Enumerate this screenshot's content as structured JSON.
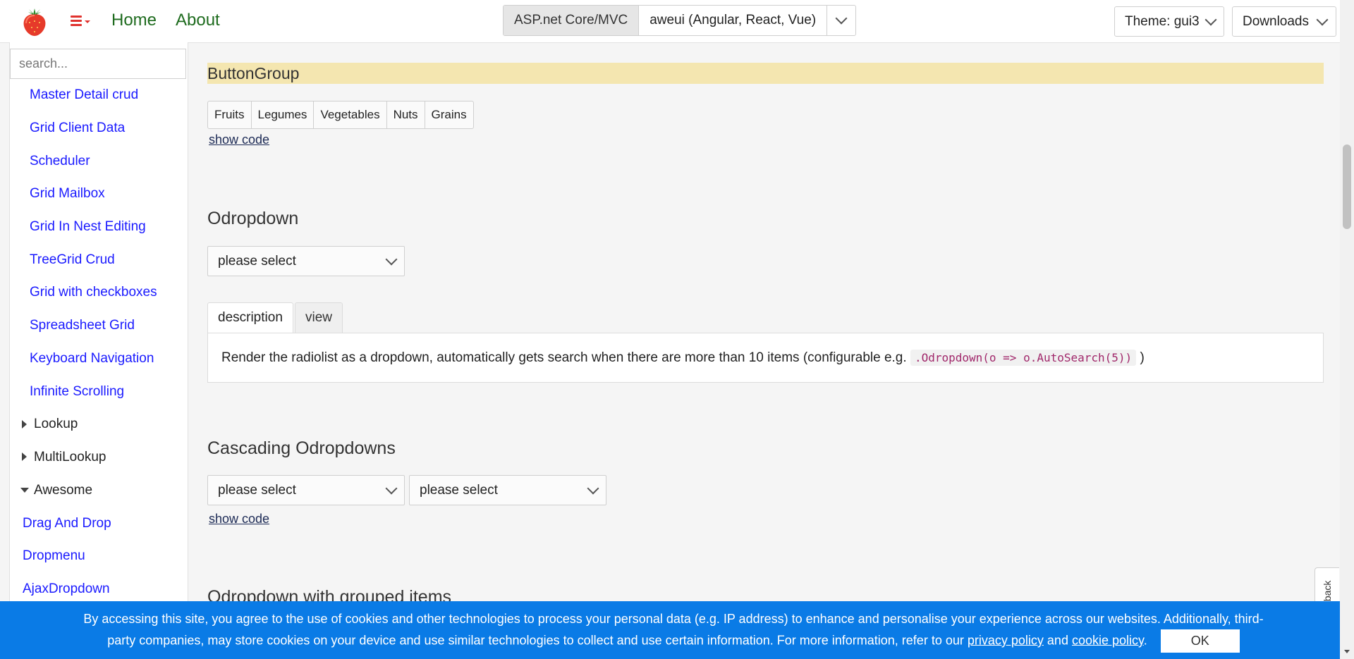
{
  "header": {
    "logo": "strawberry-logo",
    "menu_icon": "hamburger-menu-icon",
    "nav": {
      "home": "Home",
      "about": "About"
    },
    "platform_options": [
      {
        "label": "ASP.net Core/MVC",
        "selected": true
      },
      {
        "label": "aweui (Angular, React, Vue)",
        "selected": false
      }
    ],
    "theme_label": "Theme: gui3",
    "downloads_label": "Downloads"
  },
  "sidebar": {
    "search_placeholder": "search...",
    "items": [
      {
        "label": "Master Detail crud",
        "kind": "link"
      },
      {
        "label": "Grid Client Data",
        "kind": "link"
      },
      {
        "label": "Scheduler",
        "kind": "link"
      },
      {
        "label": "Grid Mailbox",
        "kind": "link"
      },
      {
        "label": "Grid In Nest Editing",
        "kind": "link"
      },
      {
        "label": "TreeGrid Crud",
        "kind": "link"
      },
      {
        "label": "Grid with checkboxes",
        "kind": "link"
      },
      {
        "label": "Spreadsheet Grid",
        "kind": "link"
      },
      {
        "label": "Keyboard Navigation",
        "kind": "link"
      },
      {
        "label": "Infinite Scrolling",
        "kind": "link"
      },
      {
        "label": "Lookup",
        "kind": "group-collapsed"
      },
      {
        "label": "MultiLookup",
        "kind": "group-collapsed"
      },
      {
        "label": "Awesome",
        "kind": "group-expanded"
      },
      {
        "label": "Drag And Drop",
        "kind": "link"
      },
      {
        "label": "Dropmenu",
        "kind": "link"
      },
      {
        "label": "AjaxDropdown",
        "kind": "link"
      }
    ]
  },
  "main": {
    "buttongroup": {
      "title": "ButtonGroup",
      "buttons": [
        "Fruits",
        "Legumes",
        "Vegetables",
        "Nuts",
        "Grains"
      ],
      "show_code": "show code"
    },
    "odropdown": {
      "title": "Odropdown",
      "select_value": "please select",
      "tabs": [
        "description",
        "view"
      ],
      "active_tab": "description",
      "description_text": "Render the radiolist as a dropdown, automatically gets search when there are more than 10 items (configurable e.g.",
      "description_code": ".Odropdown(o => o.AutoSearch(5))",
      "description_end": ")"
    },
    "cascading": {
      "title": "Cascading Odropdowns",
      "select1": "please select",
      "select2": "please select",
      "show_code": "show code"
    },
    "grouped": {
      "title": "Odropdown with grouped items"
    }
  },
  "feedback_label": "feedback",
  "cookie_banner": {
    "text_1": "By accessing this site, you agree to the use of cookies and other technologies to process your personal data (e.g. IP address) to enhance and personalise your experience across our websites. Additionally, third-party companies, may store cookies on your device and use similar technologies to collect and use certain information. For more information, refer to our",
    "privacy_link": "privacy policy",
    "and": "and",
    "cookie_link": "cookie policy",
    "period": ".",
    "ok_label": "OK"
  },
  "colors": {
    "accent_green": "#1e6b1e",
    "link_blue": "#1a1aff",
    "cookie_blue": "#0a7be6",
    "highlight": "#f4e6b0",
    "menu_red": "#e0322e"
  }
}
